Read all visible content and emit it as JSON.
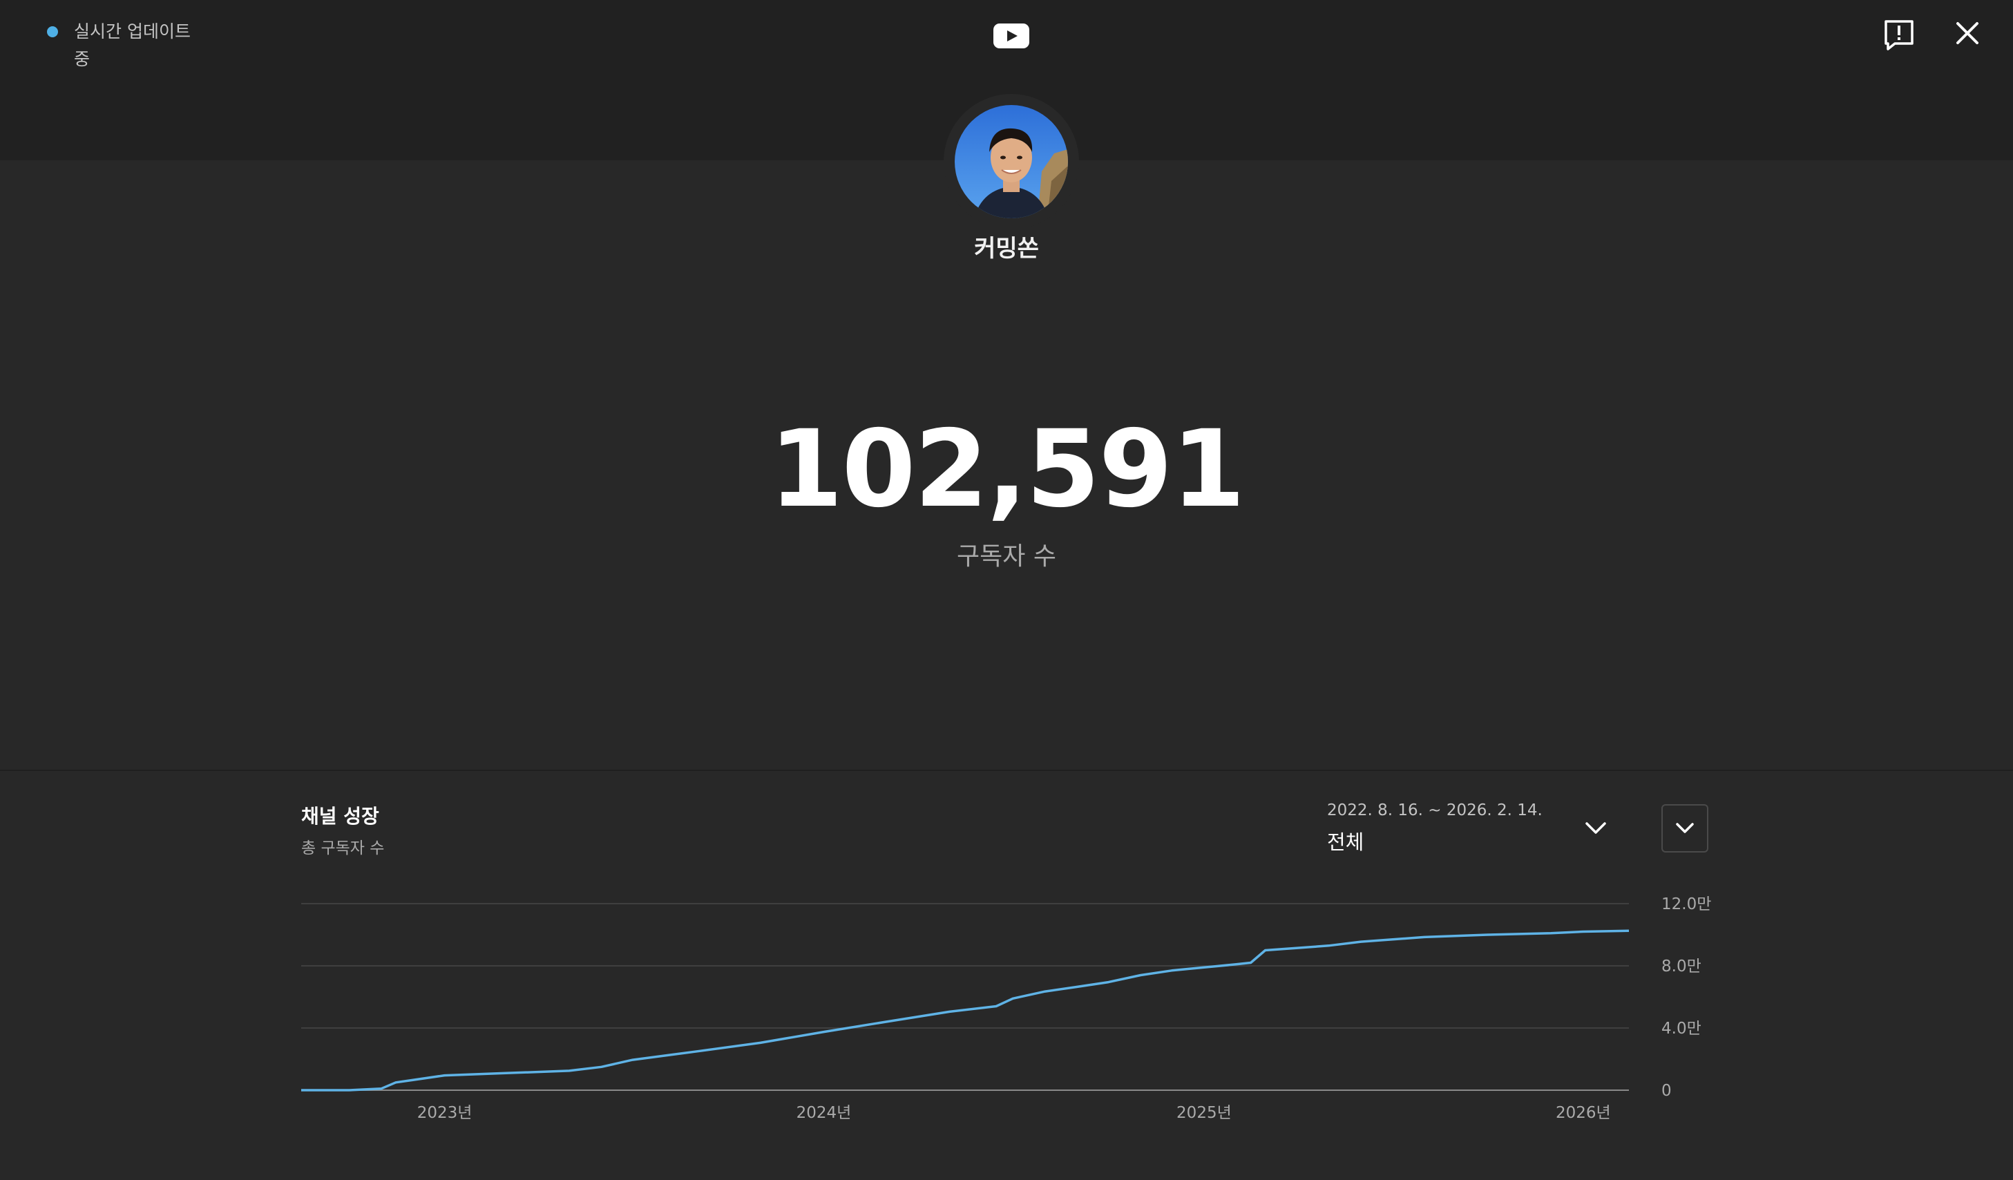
{
  "header": {
    "live_status": "실시간 업데이트 중",
    "feedback_icon": "feedback-icon",
    "close_icon": "close-icon",
    "logo_icon": "youtube-logo"
  },
  "channel": {
    "name": "커밍쏜",
    "avatar_icon": "channel-avatar"
  },
  "stats": {
    "subscriber_count": "102,591",
    "subscriber_label": "구독자 수"
  },
  "growth": {
    "title": "채널 성장",
    "subtitle": "총 구독자 수",
    "date_range": "2022. 8. 16. ~ 2026. 2. 14.",
    "range_selection": "전체",
    "range_dropdown_icon": "chevron-down-icon",
    "expand_icon": "chevron-down-icon"
  },
  "colors": {
    "live_dot": "#4fb0e6",
    "line": "#5fb3e6",
    "background": "#282828",
    "topbar": "#212121"
  },
  "chart_data": {
    "type": "line",
    "title": "채널 성장",
    "subtitle": "총 구독자 수",
    "x_tick_labels": [
      "2023년",
      "2024년",
      "2025년",
      "2026년"
    ],
    "y_tick_labels": [
      "0",
      "4.0만",
      "8.0만",
      "12.0만"
    ],
    "ylim": [
      0,
      120000
    ],
    "xlim": [
      "2022-08-16",
      "2026-02-14"
    ],
    "grid": true,
    "legend": "none",
    "series": [
      {
        "x": [
          "2022-08-16",
          "2022-10-01",
          "2022-11-01",
          "2022-11-15",
          "2022-12-01",
          "2023-01-01",
          "2023-03-01",
          "2023-05-01",
          "2023-06-01",
          "2023-07-01",
          "2023-09-01",
          "2023-11-01",
          "2024-01-01",
          "2024-03-01",
          "2024-05-01",
          "2024-06-15",
          "2024-07-01",
          "2024-08-01",
          "2024-09-01",
          "2024-10-01",
          "2024-11-01",
          "2024-12-01",
          "2025-01-01",
          "2025-02-01",
          "2025-02-15",
          "2025-03-01",
          "2025-05-01",
          "2025-06-01",
          "2025-08-01",
          "2025-10-01",
          "2025-12-01",
          "2026-01-01",
          "2026-02-14"
        ],
        "y": [
          0,
          0,
          1000,
          5000,
          6500,
          9500,
          11000,
          12500,
          15000,
          19500,
          25000,
          30500,
          37500,
          44000,
          50500,
          54000,
          59000,
          63500,
          66500,
          69500,
          74000,
          77000,
          79000,
          81000,
          82000,
          90000,
          93000,
          95500,
          98500,
          100000,
          101000,
          102000,
          102591
        ]
      }
    ]
  }
}
